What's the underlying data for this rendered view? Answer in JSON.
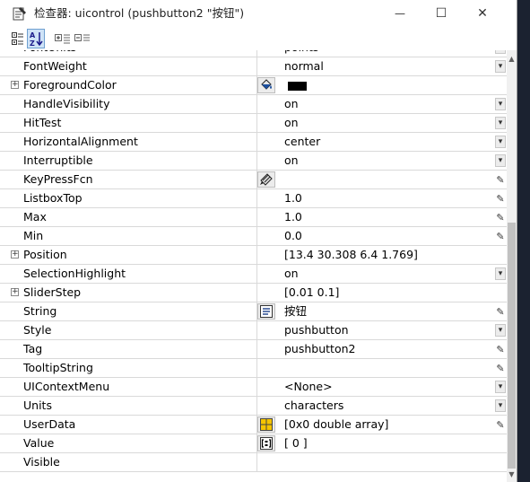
{
  "window": {
    "title": "检查器:  uicontrol (pushbutton2 \"按钮\")",
    "minimize_glyph": "—",
    "maximize_glyph": "☐",
    "close_glyph": "✕"
  },
  "toolbar": {
    "buttons": [
      {
        "name": "categorized-view-icon",
        "active": false
      },
      {
        "name": "sort-alphabetical-icon",
        "active": true
      },
      {
        "name": "expand-all-icon",
        "active": false
      },
      {
        "name": "collapse-all-icon",
        "active": false
      }
    ]
  },
  "properties": [
    {
      "name": "FontUnits",
      "value": "points",
      "control": "dropdown",
      "expandable": false
    },
    {
      "name": "FontWeight",
      "value": "normal",
      "control": "dropdown",
      "expandable": false
    },
    {
      "name": "ForegroundColor",
      "value": "",
      "icon": "paint-bucket-icon",
      "swatch_color": "#000000",
      "control": "none",
      "expandable": true
    },
    {
      "name": "HandleVisibility",
      "value": "on",
      "control": "dropdown",
      "expandable": false
    },
    {
      "name": "HitTest",
      "value": "on",
      "control": "dropdown",
      "expandable": false
    },
    {
      "name": "HorizontalAlignment",
      "value": "center",
      "control": "dropdown",
      "expandable": false
    },
    {
      "name": "Interruptible",
      "value": "on",
      "control": "dropdown",
      "expandable": false
    },
    {
      "name": "KeyPressFcn",
      "value": "",
      "icon": "callback-editor-icon",
      "control": "pencil",
      "expandable": false
    },
    {
      "name": "ListboxTop",
      "value": "1.0",
      "control": "pencil",
      "expandable": false
    },
    {
      "name": "Max",
      "value": "1.0",
      "control": "pencil",
      "expandable": false
    },
    {
      "name": "Min",
      "value": "0.0",
      "control": "pencil",
      "expandable": false
    },
    {
      "name": "Position",
      "value": "[13.4 30.308 6.4 1.769]",
      "control": "none",
      "expandable": true
    },
    {
      "name": "SelectionHighlight",
      "value": "on",
      "control": "dropdown",
      "expandable": false
    },
    {
      "name": "SliderStep",
      "value": "[0.01 0.1]",
      "control": "none",
      "expandable": true
    },
    {
      "name": "String",
      "value": "按钮",
      "icon": "text-list-icon",
      "control": "pencil",
      "expandable": false
    },
    {
      "name": "Style",
      "value": "pushbutton",
      "control": "dropdown",
      "expandable": false
    },
    {
      "name": "Tag",
      "value": "pushbutton2",
      "control": "pencil",
      "expandable": false
    },
    {
      "name": "TooltipString",
      "value": "",
      "control": "pencil",
      "expandable": false
    },
    {
      "name": "UIContextMenu",
      "value": "<None>",
      "control": "dropdown",
      "expandable": false
    },
    {
      "name": "Units",
      "value": "characters",
      "control": "dropdown",
      "expandable": false
    },
    {
      "name": "UserData",
      "value": "[0x0  double array]",
      "icon": "array-grid-icon",
      "control": "pencil",
      "expandable": false
    },
    {
      "name": "Value",
      "value": "[ 0 ]",
      "icon": "matrix-bracket-icon",
      "control": "none",
      "expandable": false
    },
    {
      "name": "Visible",
      "value": "",
      "control": "none",
      "expandable": false
    }
  ],
  "scrollbar": {
    "up_glyph": "▲",
    "down_glyph": "▼"
  },
  "glyphs": {
    "expander": "+",
    "dropdown": "▾",
    "pencil": "✎"
  }
}
